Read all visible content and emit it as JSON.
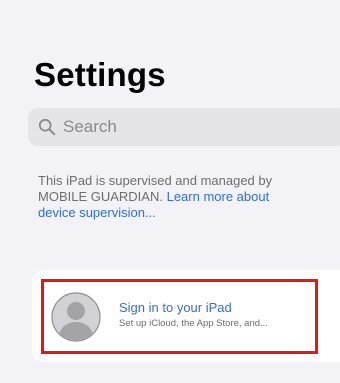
{
  "header": {
    "title": "Settings"
  },
  "search": {
    "placeholder": "Search",
    "icon": "search-icon"
  },
  "supervision": {
    "text": "This iPad is supervised and managed by MOBILE GUARDIAN.",
    "link": "Learn more about device supervision..."
  },
  "account": {
    "title": "Sign in to your iPad",
    "subtitle": "Set up iCloud, the App Store, and...",
    "icon": "person-avatar-icon",
    "highlight_color": "#e8170b"
  },
  "colors": {
    "accent": "#2f6fd6",
    "background": "#f2f2f7"
  }
}
